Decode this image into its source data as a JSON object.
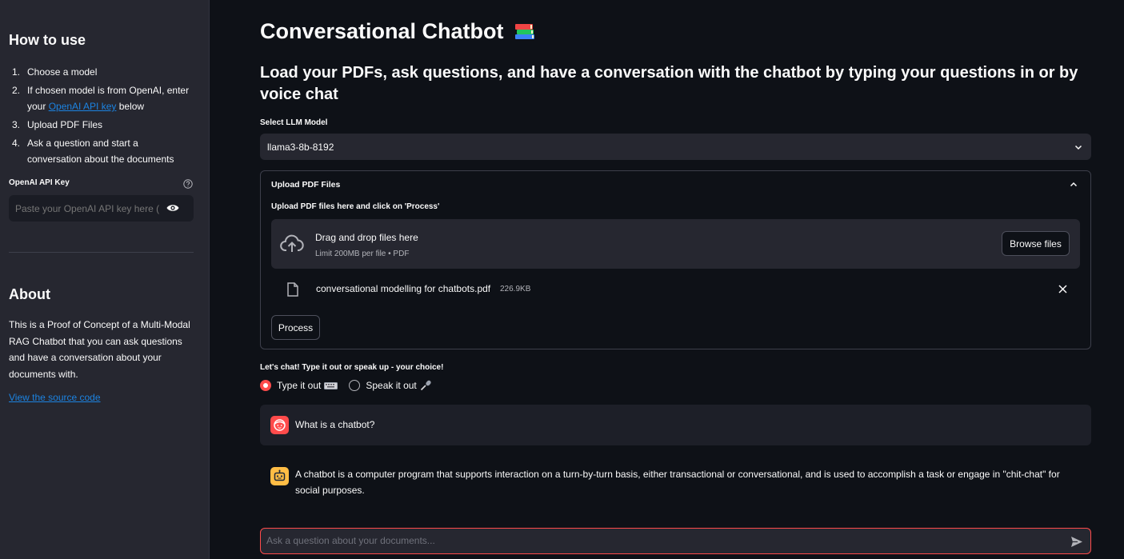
{
  "sidebar": {
    "how_to_title": "How to use",
    "steps": [
      {
        "num": "1.",
        "text": "Choose a model"
      },
      {
        "num": "2.",
        "pre": "If chosen model is from OpenAI, enter your ",
        "link": "OpenAI API key",
        "post": " below"
      },
      {
        "num": "3.",
        "text": "Upload PDF Files"
      },
      {
        "num": "4.",
        "text": "Ask a question and start a conversation about the documents"
      }
    ],
    "api_key_label": "OpenAI API Key",
    "api_key_placeholder": "Paste your OpenAI API key here (sk-...)",
    "about_title": "About",
    "about_text": "This is a Proof of Concept of a Multi-Modal RAG Chatbot that you can ask questions and have a conversation about your documents with.",
    "source_link": "View the source code"
  },
  "main": {
    "title": "Conversational Chatbot",
    "subtitle": "Load your PDFs, ask questions, and have a conversation with the chatbot by typing your questions in or by voice chat",
    "select_label": "Select LLM Model",
    "selected_model": "llama3-8b-8192",
    "expander": {
      "title": "Upload PDF Files",
      "upload_label": "Upload PDF files here and click on 'Process'",
      "drop_text": "Drag and drop files here",
      "limit_text": "Limit 200MB per file • PDF",
      "browse_label": "Browse files",
      "file_name": "conversational modelling for chatbots.pdf",
      "file_size": "226.9KB",
      "process_label": "Process"
    },
    "chat_label": "Let's chat! Type it out or speak up - your choice!",
    "radio_options": [
      "Type it out",
      "Speak it out"
    ],
    "selected_option": "Type it out",
    "messages": [
      {
        "role": "user",
        "text": "What is a chatbot?"
      },
      {
        "role": "assistant",
        "text": "A chatbot is a computer program that supports interaction on a turn-by-turn basis, either transactional or conversational, and is used to accomplish a task or engage in \"chit-chat\" for social purposes."
      }
    ],
    "chat_placeholder": "Ask a question about your documents..."
  },
  "colors": {
    "accent": "#ff4b4b",
    "link": "#1c83e1",
    "background": "#0e1117",
    "sidebar": "#262730",
    "bot_avatar": "#ffbd45"
  },
  "icons": [
    "help-icon",
    "eye-icon",
    "books-icon",
    "chevron-down-icon",
    "chevron-up-icon",
    "cloud-upload-icon",
    "file-icon",
    "close-icon",
    "keyboard-icon",
    "microphone-icon",
    "user-avatar-icon",
    "bot-avatar-icon",
    "send-icon"
  ]
}
